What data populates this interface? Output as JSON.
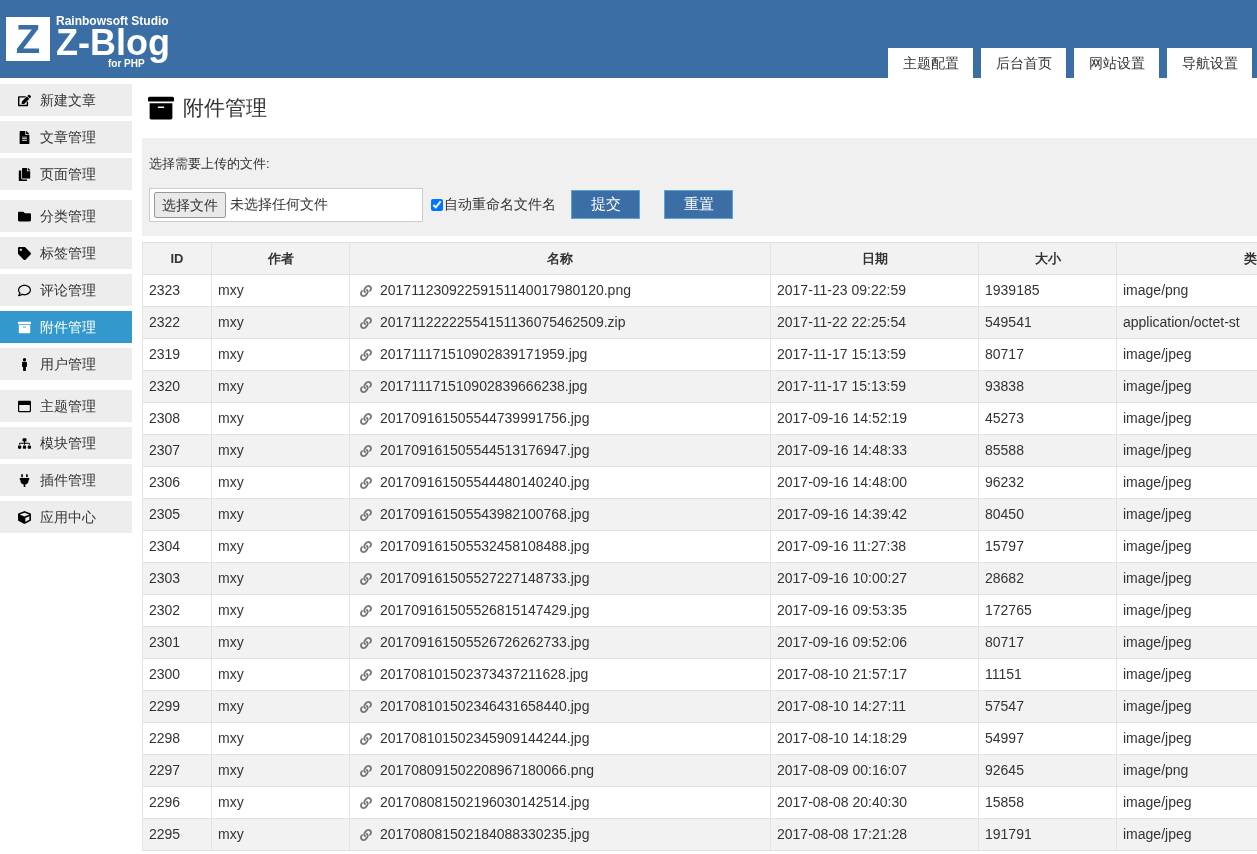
{
  "logo": {
    "mark": "Z",
    "studio": "Rainbowsoft Studio",
    "name": "Z-Blog",
    "platform": "for PHP"
  },
  "header_tabs": [
    {
      "label": "主题配置",
      "selected": false
    },
    {
      "label": "后台首页",
      "selected": false
    },
    {
      "label": "网站设置",
      "selected": false
    },
    {
      "label": "导航设置",
      "selected": false
    }
  ],
  "sidebar": {
    "groups": [
      {
        "items": [
          {
            "label": "新建文章",
            "selected": false
          },
          {
            "label": "文章管理",
            "selected": false
          },
          {
            "label": "页面管理",
            "selected": false
          }
        ]
      },
      {
        "items": [
          {
            "label": "分类管理",
            "selected": false
          },
          {
            "label": "标签管理",
            "selected": false
          },
          {
            "label": "评论管理",
            "selected": false
          },
          {
            "label": "附件管理",
            "selected": true
          },
          {
            "label": "用户管理",
            "selected": false
          }
        ]
      },
      {
        "items": [
          {
            "label": "主题管理",
            "selected": false
          },
          {
            "label": "模块管理",
            "selected": false
          },
          {
            "label": "插件管理",
            "selected": false
          },
          {
            "label": "应用中心",
            "selected": false
          }
        ]
      }
    ]
  },
  "page_title": "附件管理",
  "upload": {
    "label": "选择需要上传的文件:",
    "choose_button": "选择文件",
    "file_status": "未选择任何文件",
    "auto_rename": {
      "label": "自动重命名文件名",
      "checked": true
    },
    "buttons": [
      "提交",
      "重置"
    ]
  },
  "table": {
    "columns": [
      "ID",
      "作者",
      "名称",
      "日期",
      "大小",
      "类"
    ],
    "rows": [
      [
        "2323",
        "mxy",
        "20171123092259151140017980120.png",
        "2017-11-23 09:22:59",
        "1939185",
        "image/png"
      ],
      [
        "2322",
        "mxy",
        "20171122222554151136075462509.zip",
        "2017-11-22 22:25:54",
        "549541",
        "application/octet-st"
      ],
      [
        "2319",
        "mxy",
        "201711171510902839171959.jpg",
        "2017-11-17 15:13:59",
        "80717",
        "image/jpeg"
      ],
      [
        "2320",
        "mxy",
        "201711171510902839666238.jpg",
        "2017-11-17 15:13:59",
        "93838",
        "image/jpeg"
      ],
      [
        "2308",
        "mxy",
        "201709161505544739991756.jpg",
        "2017-09-16 14:52:19",
        "45273",
        "image/jpeg"
      ],
      [
        "2307",
        "mxy",
        "201709161505544513176947.jpg",
        "2017-09-16 14:48:33",
        "85588",
        "image/jpeg"
      ],
      [
        "2306",
        "mxy",
        "201709161505544480140240.jpg",
        "2017-09-16 14:48:00",
        "96232",
        "image/jpeg"
      ],
      [
        "2305",
        "mxy",
        "201709161505543982100768.jpg",
        "2017-09-16 14:39:42",
        "80450",
        "image/jpeg"
      ],
      [
        "2304",
        "mxy",
        "201709161505532458108488.jpg",
        "2017-09-16 11:27:38",
        "15797",
        "image/jpeg"
      ],
      [
        "2303",
        "mxy",
        "201709161505527227148733.jpg",
        "2017-09-16 10:00:27",
        "28682",
        "image/jpeg"
      ],
      [
        "2302",
        "mxy",
        "201709161505526815147429.jpg",
        "2017-09-16 09:53:35",
        "172765",
        "image/jpeg"
      ],
      [
        "2301",
        "mxy",
        "201709161505526726262733.jpg",
        "2017-09-16 09:52:06",
        "80717",
        "image/jpeg"
      ],
      [
        "2300",
        "mxy",
        "201708101502373437211628.jpg",
        "2017-08-10 21:57:17",
        "11151",
        "image/jpeg"
      ],
      [
        "2299",
        "mxy",
        "201708101502346431658440.jpg",
        "2017-08-10 14:27:11",
        "57547",
        "image/jpeg"
      ],
      [
        "2298",
        "mxy",
        "201708101502345909144244.jpg",
        "2017-08-10 14:18:29",
        "54997",
        "image/jpeg"
      ],
      [
        "2297",
        "mxy",
        "201708091502208967180066.png",
        "2017-08-09 00:16:07",
        "92645",
        "image/png"
      ],
      [
        "2296",
        "mxy",
        "201708081502196030142514.jpg",
        "2017-08-08 20:40:30",
        "15858",
        "image/jpeg"
      ],
      [
        "2295",
        "mxy",
        "201708081502184088330235.jpg",
        "2017-08-08 17:21:28",
        "191791",
        "image/jpeg"
      ]
    ]
  }
}
